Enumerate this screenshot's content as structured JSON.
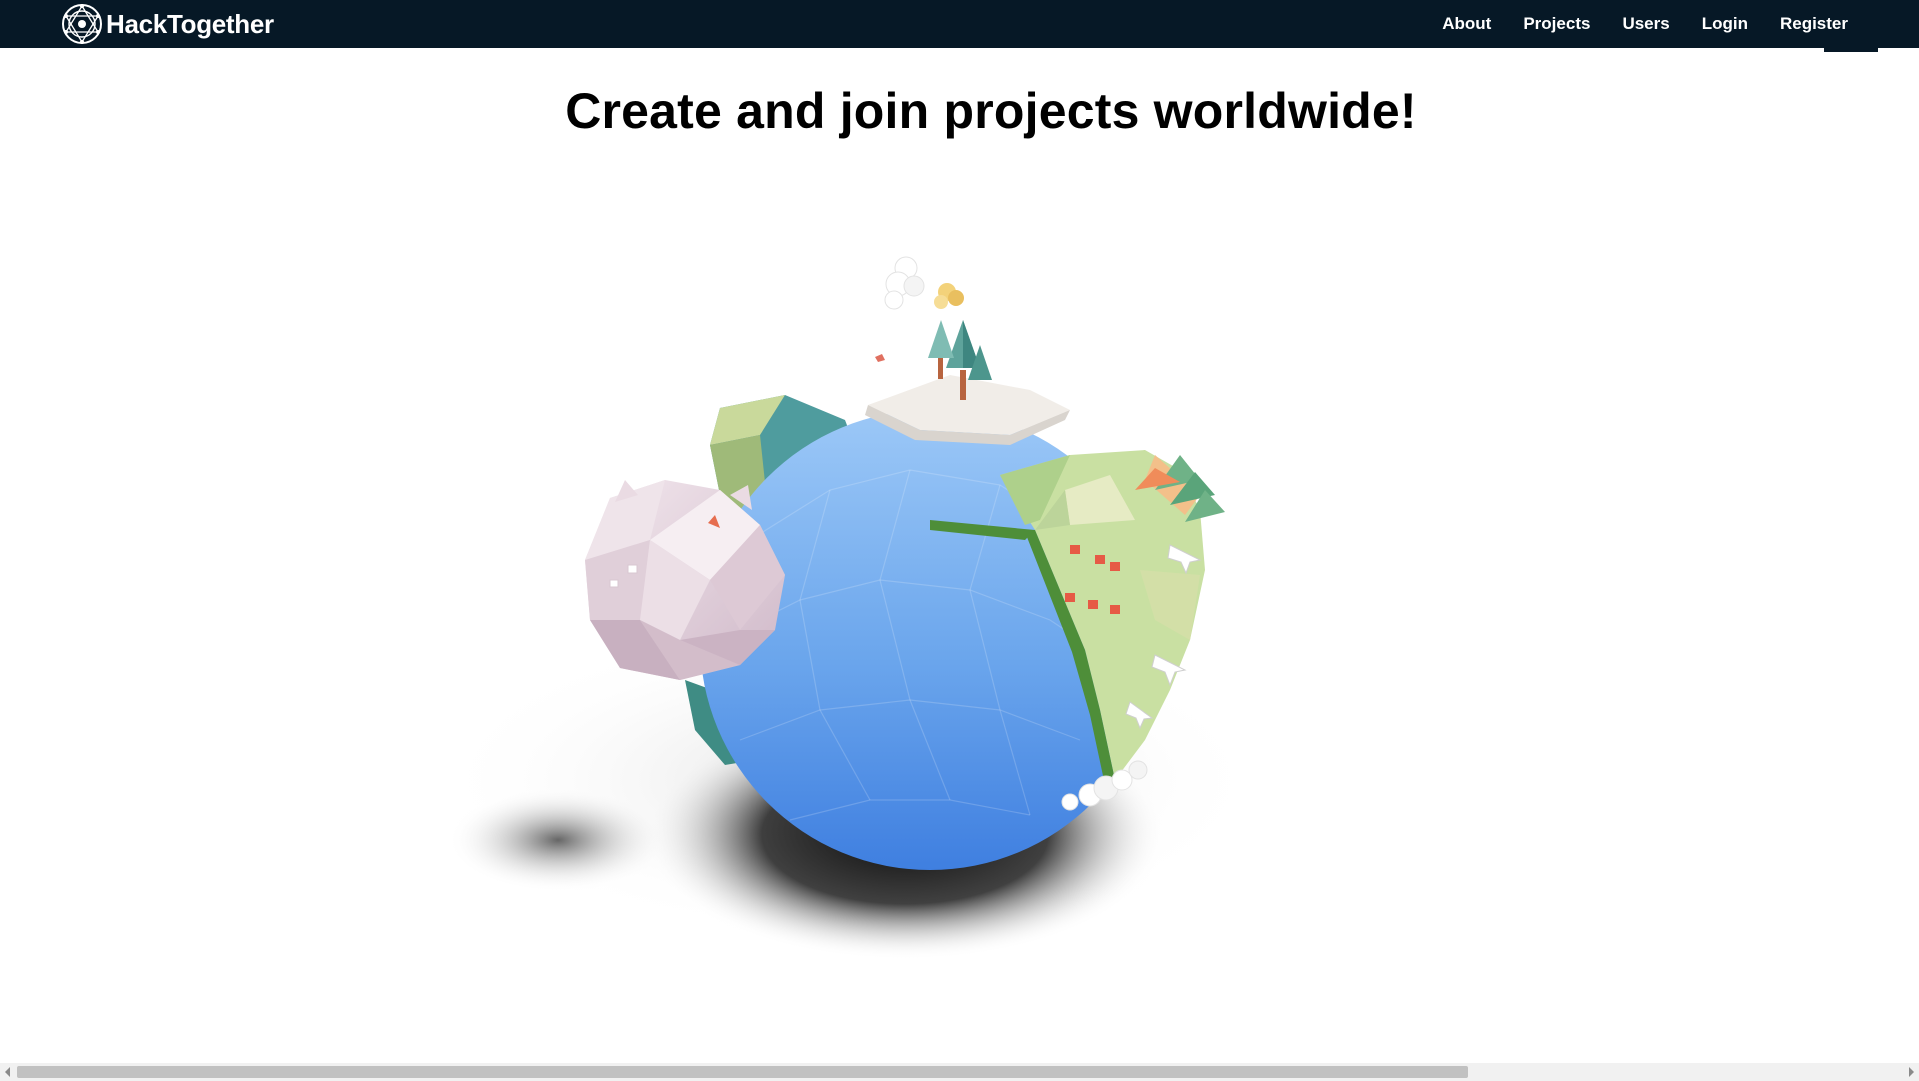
{
  "navbar": {
    "brand": "HackTogether",
    "brand_logo_icon": "globe-network-icon",
    "links": [
      {
        "label": "About"
      },
      {
        "label": "Projects"
      },
      {
        "label": "Users"
      },
      {
        "label": "Login"
      },
      {
        "label": "Register"
      }
    ],
    "background_color": "#061826"
  },
  "main": {
    "headline": "Create and join projects worldwide!",
    "hero_image": "low-poly-planet-illustration"
  },
  "scrollbar": {
    "horizontal_thumb_fraction": 0.76
  }
}
